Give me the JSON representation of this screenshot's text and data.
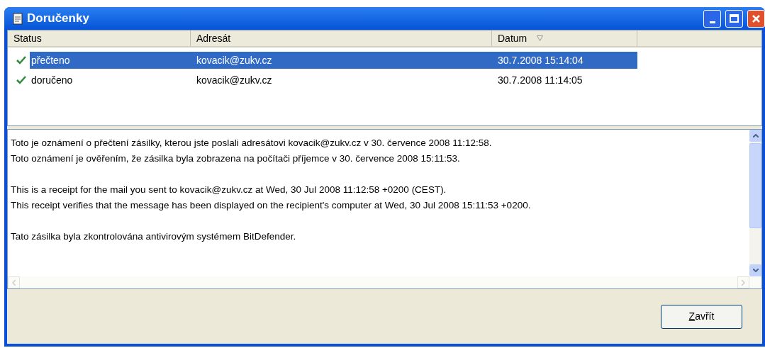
{
  "window": {
    "title": "Doručenky"
  },
  "table": {
    "columns": [
      {
        "label": "Status",
        "sorted": false
      },
      {
        "label": "Adresát",
        "sorted": false
      },
      {
        "label": "Datum",
        "sorted": true
      }
    ],
    "rows": [
      {
        "status": "přečteno",
        "recipient": "kovacik@zukv.cz",
        "date": "30.7.2008 15:14:04",
        "selected": true
      },
      {
        "status": "doručeno",
        "recipient": "kovacik@zukv.cz",
        "date": "30.7.2008 11:14:05",
        "selected": false
      }
    ]
  },
  "message": {
    "paragraphs": [
      [
        "Toto je oznámení o přečtení zásilky, kterou jste poslali adresátovi kovacik@zukv.cz v 30. července 2008 11:12:58.",
        "Toto oznámení je ověřením, že zásilka byla zobrazena na počítači příjemce v 30. července 2008 15:11:53."
      ],
      [
        "This is a receipt for the mail you sent to kovacik@zukv.cz at Wed, 30 Jul 2008 11:12:58 +0200 (CEST).",
        "This receipt verifies that the message has been displayed on the recipient's computer at Wed, 30 Jul 2008 15:11:53 +0200."
      ],
      [
        "Tato zásilka byla zkontrolována antivirovým systémem BitDefender."
      ]
    ]
  },
  "buttons": [
    {
      "label": "Zavřít"
    }
  ]
}
